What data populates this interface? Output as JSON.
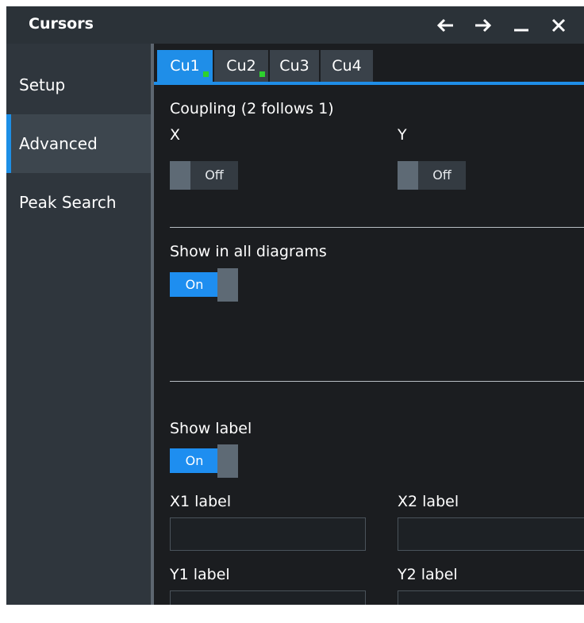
{
  "window": {
    "title": "Cursors",
    "controls": [
      {
        "icon": "back-arrow-icon"
      },
      {
        "icon": "forward-arrow-icon"
      },
      {
        "icon": "minimize-icon"
      },
      {
        "icon": "close-icon"
      }
    ]
  },
  "sidebar": {
    "items": [
      {
        "label": "Setup",
        "active": false
      },
      {
        "label": "Advanced",
        "active": true
      },
      {
        "label": "Peak Search",
        "active": false
      }
    ]
  },
  "tabs": [
    {
      "label": "Cu1",
      "active": true,
      "indicator": true
    },
    {
      "label": "Cu2",
      "active": false,
      "indicator": true
    },
    {
      "label": "Cu3",
      "active": false,
      "indicator": false
    },
    {
      "label": "Cu4",
      "active": false,
      "indicator": false
    }
  ],
  "coupling": {
    "title": "Coupling (2 follows 1)",
    "x": {
      "label": "X",
      "state": "Off"
    },
    "y": {
      "label": "Y",
      "state": "Off"
    }
  },
  "show_all": {
    "label": "Show in all diagrams",
    "state": "On"
  },
  "show_label": {
    "label": "Show label",
    "state": "On"
  },
  "labels": {
    "x1": {
      "label": "X1 label",
      "value": ""
    },
    "x2": {
      "label": "X2 label",
      "value": ""
    },
    "y1": {
      "label": "Y1 label",
      "value": ""
    },
    "y2": {
      "label": "Y2 label",
      "value": ""
    }
  },
  "colors": {
    "accent": "#1f8ee8",
    "indicator": "#2ed12e",
    "sidebar": "#2f363d",
    "panel": "#1b1d20"
  }
}
